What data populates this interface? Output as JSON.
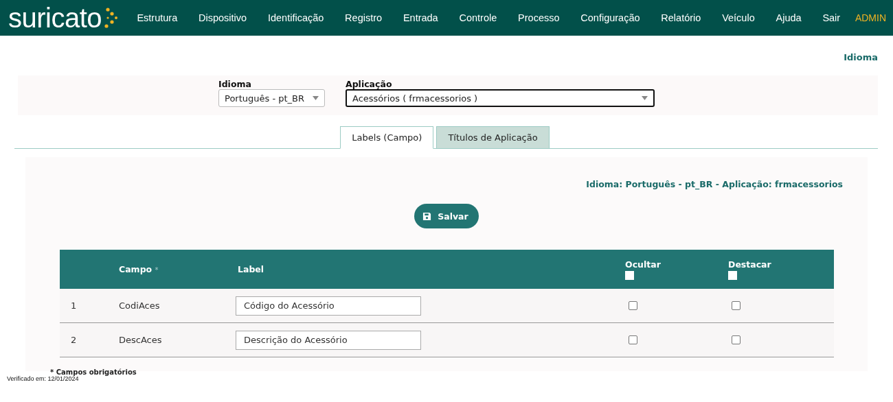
{
  "header": {
    "logo": "suricato",
    "nav": [
      {
        "label": "Estrutura"
      },
      {
        "label": "Dispositivo"
      },
      {
        "label": "Identificação"
      },
      {
        "label": "Registro"
      },
      {
        "label": "Entrada"
      },
      {
        "label": "Controle"
      },
      {
        "label": "Processo"
      },
      {
        "label": "Configuração"
      },
      {
        "label": "Relatório"
      },
      {
        "label": "Veículo"
      },
      {
        "label": "Ajuda"
      },
      {
        "label": "Sair"
      }
    ],
    "user": "ADMIN"
  },
  "page_title": "Idioma",
  "filters": [
    {
      "label": "Idioma",
      "value": "Português - pt_BR",
      "focused": false
    },
    {
      "label": "Aplicação",
      "value": "Acessórios ( frmacessorios )",
      "focused": true
    }
  ],
  "tabs": [
    {
      "label": "Labels (Campo)",
      "selected": true
    },
    {
      "label": "Títulos de Aplicação",
      "selected": false
    }
  ],
  "context": "Idioma: Português - pt_BR - Aplicação: frmacessorios",
  "save_button": "Salvar",
  "table": {
    "columns": [
      {
        "label": "Campo",
        "required_mark": "*"
      },
      {
        "label": "Label"
      },
      {
        "label": "Ocultar",
        "checkbox": false
      },
      {
        "label": "Destacar",
        "checkbox": false
      }
    ],
    "rows": [
      {
        "number": "1",
        "campo": "CodiAces",
        "label": "Código do Acessório",
        "ocultar": false,
        "destacar": false
      },
      {
        "number": "2",
        "campo": "DescAces",
        "label": "Descrição do Acessório",
        "ocultar": false,
        "destacar": false
      }
    ]
  },
  "footnote": "* Campos obrigatórios",
  "verified": "Verificado em: 12/01/2024"
}
